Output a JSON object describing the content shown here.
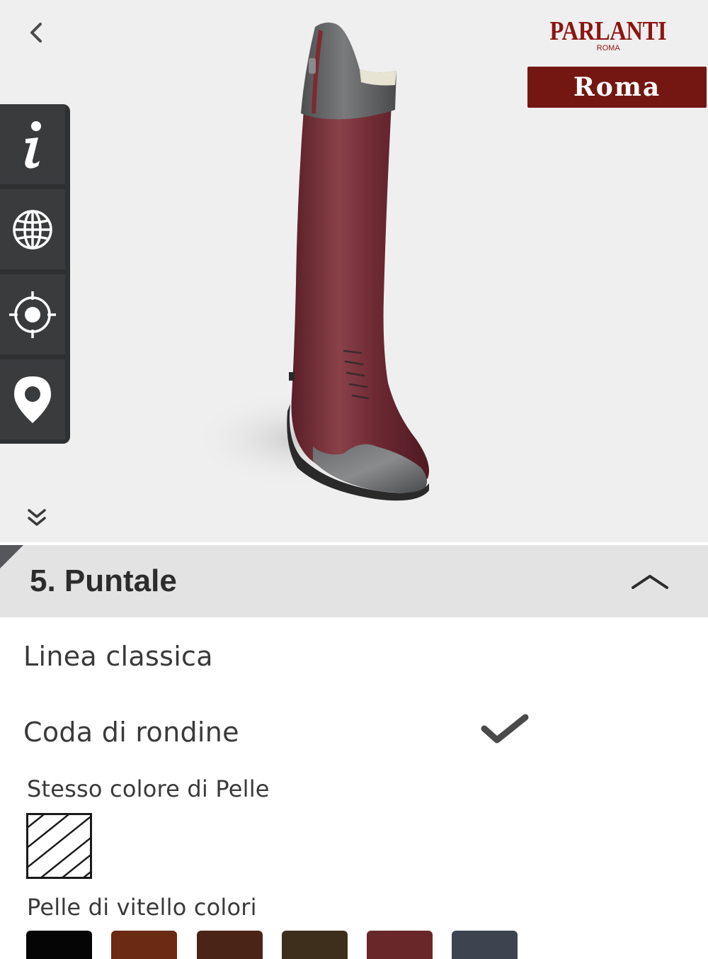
{
  "header": {
    "brand_name": "PARLANTI",
    "brand_sub": "ROMA",
    "city_button": "Roma"
  },
  "icons": {
    "back": "chevron-left-icon",
    "info": "info-icon",
    "globe": "globe-icon",
    "target": "crosshair-icon",
    "location": "map-pin-icon",
    "expand": "double-chevron-down-icon",
    "collapse": "chevron-up-icon",
    "check": "checkmark-icon"
  },
  "section": {
    "title": "5. Puntale",
    "options": [
      {
        "label": "Linea classica",
        "selected": false
      },
      {
        "label": "Coda di rondine",
        "selected": true
      }
    ],
    "same_color_label": "Stesso colore di Pelle",
    "calf_colors_label": "Pelle di vitello colori",
    "swatch_colors": [
      "#050505",
      "#6b2a12",
      "#4a2517",
      "#3d2f1c",
      "#6a2729",
      "#3d4450"
    ]
  },
  "colors": {
    "brand": "#8c1512",
    "badge": "#741712",
    "toolbar": "#2f3031",
    "section_header": "#e3e3e3",
    "boot_body": "#6e2a33",
    "boot_trim": "#5f6062"
  }
}
